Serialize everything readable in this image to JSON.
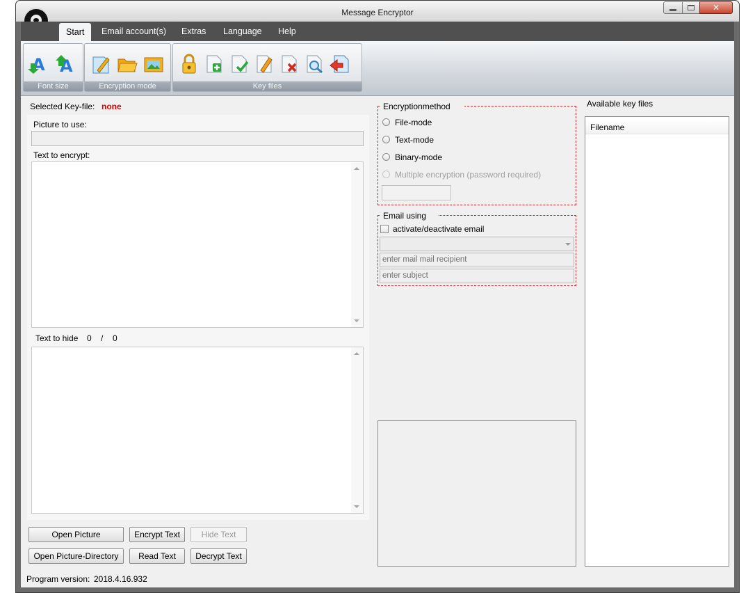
{
  "window": {
    "title": "Message Encryptor"
  },
  "ribbon": {
    "tabs": [
      "Start",
      "Email account(s)",
      "Extras",
      "Language",
      "Help"
    ],
    "groups": {
      "font_size": "Font size",
      "encryption_mode": "Encryption mode",
      "key_files": "Key files"
    }
  },
  "left": {
    "selected_key_label": "Selected Key-file:",
    "selected_key_value": "none",
    "picture_label": "Picture to use:",
    "encrypt_label": "Text to encrypt:",
    "hide_label": "Text to hide",
    "hide_count": "0",
    "hide_sep": "/",
    "hide_total": "0"
  },
  "buttons": {
    "open_picture": "Open Picture",
    "encrypt_text": "Encrypt Text",
    "hide_text": "Hide Text",
    "open_picture_dir": "Open Picture-Directory",
    "read_text": "Read Text",
    "decrypt_text": "Decrypt Text"
  },
  "encryption": {
    "legend": "Encryptionmethod",
    "file_mode": "File-mode",
    "text_mode": "Text-mode",
    "binary_mode": "Binary-mode",
    "multiple": "Multiple encryption (password required)"
  },
  "email": {
    "legend": "Email using",
    "activate": "activate/deactivate email",
    "recipient_placeholder": "enter mail mail recipient",
    "subject_placeholder": "enter subject"
  },
  "keyfiles": {
    "title": "Available key files",
    "column": "Filename"
  },
  "status": {
    "version_label": "Program version:",
    "version": "2018.4.16.932"
  }
}
